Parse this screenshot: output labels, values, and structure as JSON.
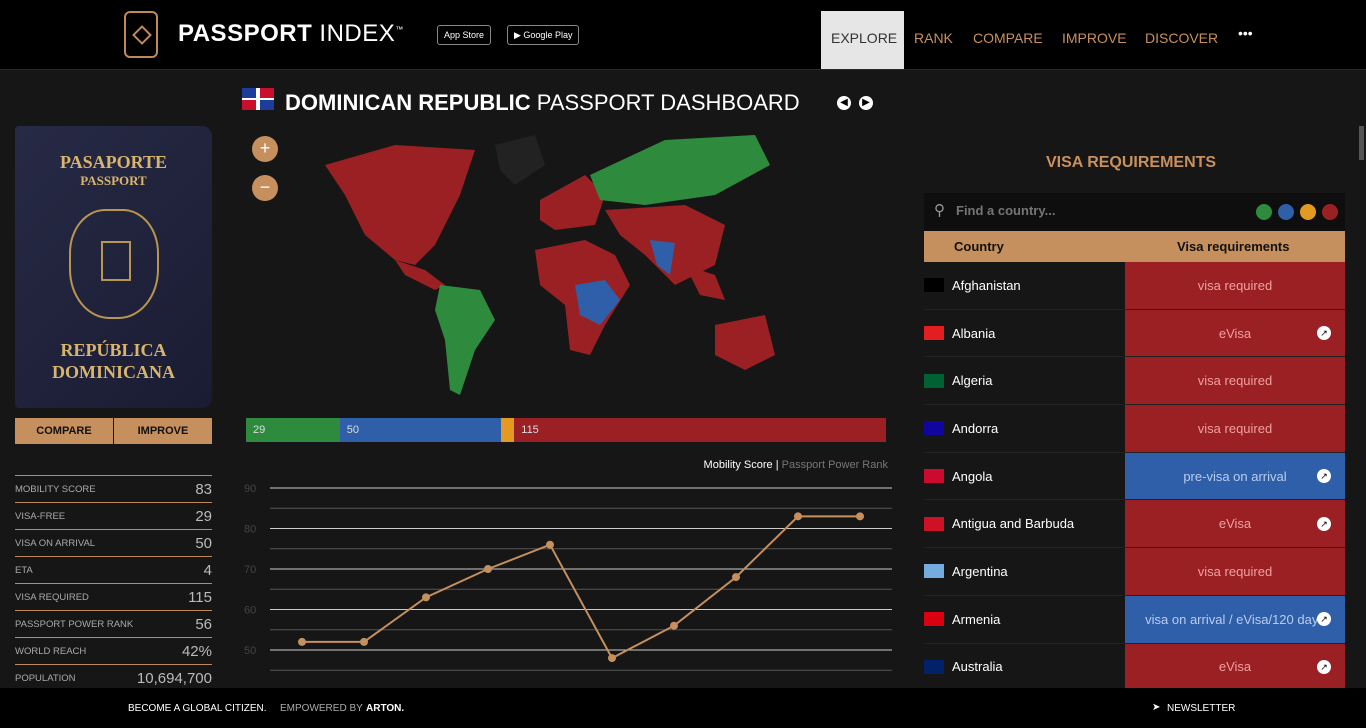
{
  "header": {
    "brand_bold": "PASSPORT",
    "brand_light": "INDEX",
    "tm": "™",
    "app_store": "App Store",
    "google_play": "Google Play",
    "nav": [
      {
        "label": "EXPLORE",
        "active": true
      },
      {
        "label": "RANK"
      },
      {
        "label": "COMPARE"
      },
      {
        "label": "IMPROVE"
      },
      {
        "label": "DISCOVER"
      },
      {
        "label": "•••"
      }
    ]
  },
  "passport": {
    "line1": "PASAPORTE",
    "line2": "PASSPORT",
    "line3": "REPÚBLICA",
    "line4": "DOMINICANA",
    "compare": "COMPARE",
    "improve": "IMPROVE"
  },
  "stats": [
    {
      "label": "MOBILITY SCORE",
      "value": "83"
    },
    {
      "label": "VISA-FREE",
      "value": "29"
    },
    {
      "label": "VISA ON ARRIVAL",
      "value": "50"
    },
    {
      "label": "ETA",
      "value": "4"
    },
    {
      "label": "VISA REQUIRED",
      "value": "115"
    },
    {
      "label": "PASSPORT POWER RANK",
      "value": "56"
    },
    {
      "label": "WORLD REACH",
      "value": "42%"
    },
    {
      "label": "POPULATION",
      "value": "10,694,700"
    }
  ],
  "dashboard": {
    "country": "DOMINICAN REPUBLIC",
    "suffix": "PASSPORT DASHBOARD",
    "zoom_in": "+",
    "zoom_out": "−"
  },
  "colors": {
    "visa_free": "#2e8b3e",
    "visa_on_arrival": "#2f5fa8",
    "eta": "#e39a22",
    "visa_required": "#9a2024",
    "accent": "#c58f5e"
  },
  "breakdown": [
    {
      "value": 29,
      "color": "#2e8b3e"
    },
    {
      "value": 50,
      "color": "#2f5fa8"
    },
    {
      "value": 4,
      "color": "#e39a22"
    },
    {
      "value": 115,
      "color": "#9a2024"
    }
  ],
  "chart_data": {
    "type": "line",
    "legend_active": "Mobility Score",
    "legend_sep": "|",
    "legend_inactive": "Passport Power Rank",
    "y_ticks": [
      90,
      80,
      70,
      60,
      50
    ],
    "ylim": [
      40,
      90
    ],
    "grid": true,
    "series": [
      {
        "values": [
          52,
          52,
          63,
          70,
          76,
          48,
          56,
          68,
          83,
          83
        ]
      }
    ]
  },
  "visa": {
    "title": "VISA REQUIREMENTS",
    "search_placeholder": "Find a country...",
    "col_country": "Country",
    "col_req": "Visa requirements",
    "rows": [
      {
        "country": "Afghanistan",
        "req": "visa required",
        "type": "red",
        "link": false
      },
      {
        "country": "Albania",
        "req": "eVisa",
        "type": "red",
        "link": true
      },
      {
        "country": "Algeria",
        "req": "visa required",
        "type": "red",
        "link": false
      },
      {
        "country": "Andorra",
        "req": "visa required",
        "type": "red",
        "link": false
      },
      {
        "country": "Angola",
        "req": "pre-visa on arrival",
        "type": "blue",
        "link": true
      },
      {
        "country": "Antigua and Barbuda",
        "req": "eVisa",
        "type": "red",
        "link": true
      },
      {
        "country": "Argentina",
        "req": "visa required",
        "type": "red",
        "link": false
      },
      {
        "country": "Armenia",
        "req": "visa on arrival / eVisa/120 days",
        "type": "blue",
        "link": true
      },
      {
        "country": "Australia",
        "req": "eVisa",
        "type": "red",
        "link": true
      }
    ]
  },
  "footer": {
    "slogan": "BECOME A GLOBAL CITIZEN.",
    "empowered": "EMPOWERED BY",
    "arton": "ARTON.",
    "newsletter": "NEWSLETTER"
  }
}
